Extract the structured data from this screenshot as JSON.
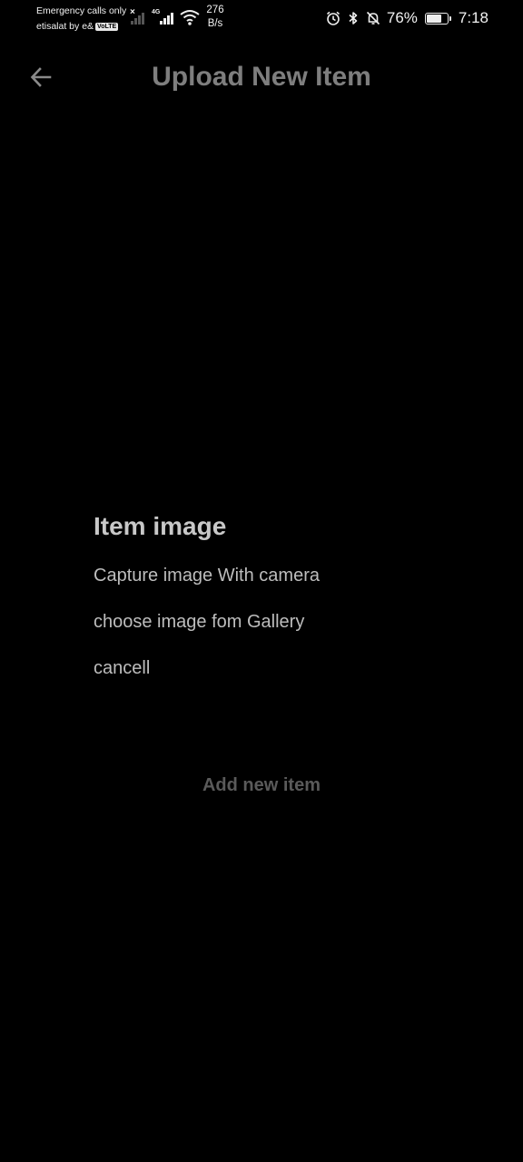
{
  "status_bar": {
    "carrier_line1": "Emergency calls only",
    "carrier_line2": "etisalat by e&",
    "volte_badge": "VoLTE",
    "no_sim_mark": "×",
    "network_type": "4G",
    "speed_value": "276",
    "speed_unit": "B/s",
    "battery_percent": "76%",
    "battery_level": 0.76,
    "time": "7:18",
    "icons": [
      "signal-dim-icon",
      "signal-4g-icon",
      "wifi-icon",
      "alarm-icon",
      "bluetooth-icon",
      "bell-off-icon",
      "battery-icon"
    ]
  },
  "app_bar": {
    "back_icon": "arrow-left-icon",
    "title": "Upload New Item"
  },
  "dialog": {
    "title": "Item image",
    "options": [
      "Capture image With camera",
      "choose image fom Gallery",
      "cancell"
    ]
  },
  "actions": {
    "add_new_item": "Add new item"
  },
  "colors": {
    "background": "#000000",
    "title_text": "#7e7e7e",
    "dialog_title": "#c8c8c8",
    "dialog_option": "#bdbdbd",
    "disabled_button": "#5a5a5a"
  }
}
